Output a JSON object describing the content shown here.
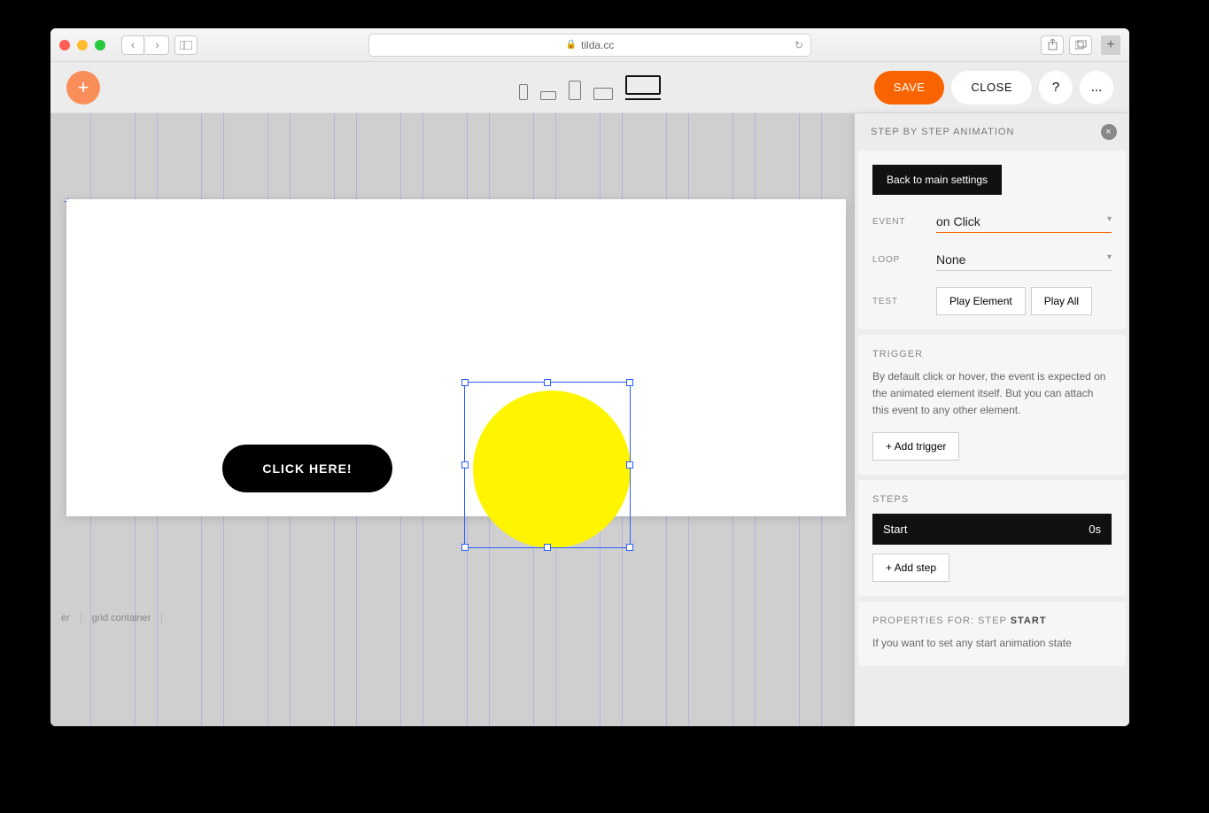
{
  "browser": {
    "url_host": "tilda.cc"
  },
  "toolbar": {
    "save": "SAVE",
    "close": "CLOSE",
    "help": "?",
    "more": "..."
  },
  "canvas": {
    "button_text": "CLICK HERE!",
    "breadcrumb_1": "er",
    "breadcrumb_2": "grid container"
  },
  "panel": {
    "title": "STEP BY STEP ANIMATION",
    "back": "Back to main settings",
    "event_label": "EVENT",
    "event_value": "on Click",
    "loop_label": "LOOP",
    "loop_value": "None",
    "test_label": "TEST",
    "play_element": "Play Element",
    "play_all": "Play All",
    "trigger_title": "TRIGGER",
    "trigger_desc": "By default click or hover, the event is expected on the animated element itself. But you can attach this event to any other element.",
    "add_trigger": "+ Add trigger",
    "steps_title": "STEPS",
    "step_start": "Start",
    "step_time": "0s",
    "add_step": "+ Add step",
    "props_prefix": "PROPERTIES FOR: STEP ",
    "props_step": "START",
    "props_desc": "If you want to set any start animation state"
  }
}
